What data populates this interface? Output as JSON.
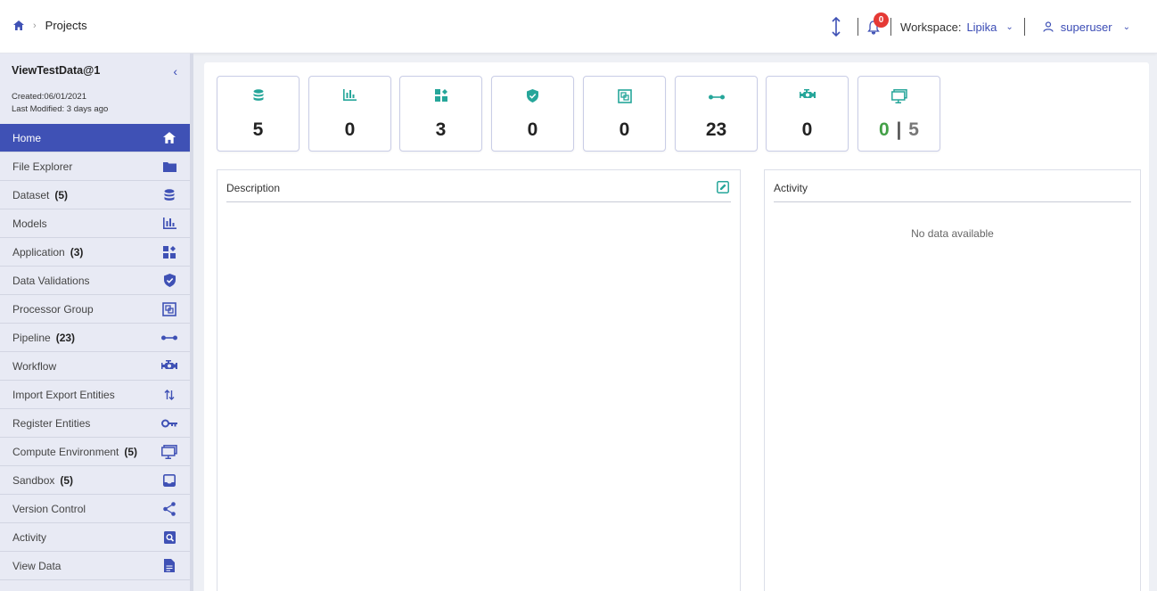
{
  "header": {
    "breadcrumb_current": "Projects",
    "notifications_count": "0",
    "workspace_label": "Workspace:",
    "workspace_value": "Lipika",
    "username": "superuser"
  },
  "sidebar": {
    "project_name": "ViewTestData@1",
    "created": "Created:06/01/2021",
    "last_modified": "Last Modified: 3 days ago",
    "items": [
      {
        "label": "Home",
        "count": "",
        "icon": "home-icon"
      },
      {
        "label": "File Explorer",
        "count": "",
        "icon": "folder-icon"
      },
      {
        "label": "Dataset",
        "count": "(5)",
        "icon": "database-icon"
      },
      {
        "label": "Models",
        "count": "",
        "icon": "bar-chart-icon"
      },
      {
        "label": "Application",
        "count": "(3)",
        "icon": "widgets-icon"
      },
      {
        "label": "Data Validations",
        "count": "",
        "icon": "shield-check-icon"
      },
      {
        "label": "Processor Group",
        "count": "",
        "icon": "processor-group-icon"
      },
      {
        "label": "Pipeline",
        "count": "(23)",
        "icon": "pipeline-icon"
      },
      {
        "label": "Workflow",
        "count": "",
        "icon": "workflow-icon"
      },
      {
        "label": "Import Export Entities",
        "count": "",
        "icon": "import-export-icon"
      },
      {
        "label": "Register Entities",
        "count": "",
        "icon": "key-icon"
      },
      {
        "label": "Compute Environment",
        "count": "(5)",
        "icon": "monitor-icon"
      },
      {
        "label": "Sandbox",
        "count": "(5)",
        "icon": "inbox-icon"
      },
      {
        "label": "Version Control",
        "count": "",
        "icon": "share-icon"
      },
      {
        "label": "Activity",
        "count": "",
        "icon": "search-doc-icon"
      },
      {
        "label": "View Data",
        "count": "",
        "icon": "document-icon"
      }
    ]
  },
  "stats": [
    {
      "icon": "database-icon",
      "value": "5"
    },
    {
      "icon": "bar-chart-icon",
      "value": "0"
    },
    {
      "icon": "widgets-icon",
      "value": "3"
    },
    {
      "icon": "shield-check-icon",
      "value": "0"
    },
    {
      "icon": "processor-group-icon",
      "value": "0"
    },
    {
      "icon": "pipeline-icon",
      "value": "23"
    },
    {
      "icon": "workflow-icon",
      "value": "0"
    },
    {
      "icon": "monitor-icon",
      "value_active": "0",
      "separator": "|",
      "value_total": "5"
    }
  ],
  "description_panel": {
    "title": "Description"
  },
  "activity_panel": {
    "title": "Activity",
    "empty_text": "No data available"
  },
  "colors": {
    "primary": "#3f51b5",
    "teal": "#26a69a",
    "green": "#43a047",
    "badge": "#e53935"
  }
}
